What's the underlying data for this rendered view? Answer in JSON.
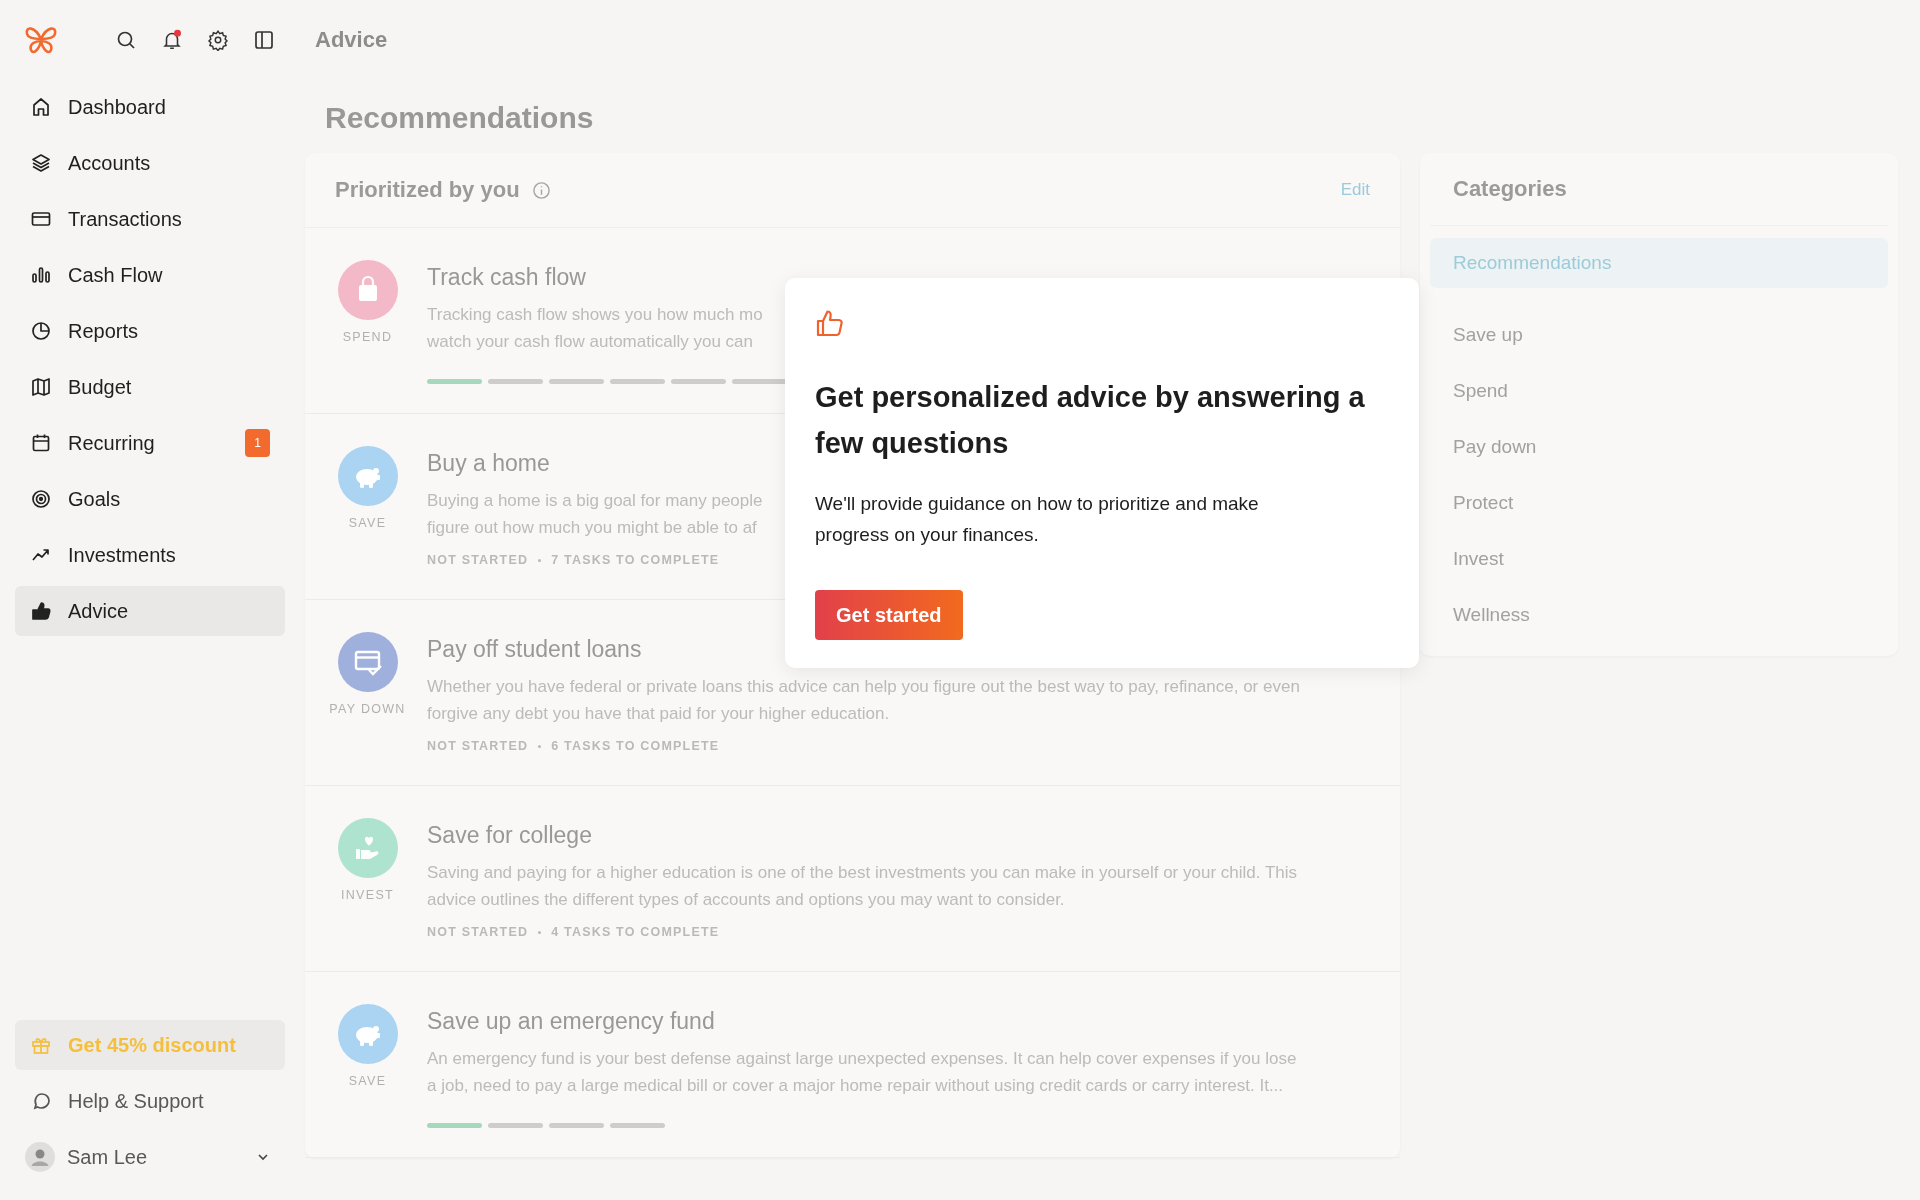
{
  "topbar": {
    "title": "Advice",
    "notification_dot": true
  },
  "sidebar": {
    "items": [
      {
        "label": "Dashboard",
        "kind": "home",
        "selected": false
      },
      {
        "label": "Accounts",
        "kind": "layers",
        "selected": false
      },
      {
        "label": "Transactions",
        "kind": "card",
        "selected": false
      },
      {
        "label": "Cash Flow",
        "kind": "bars",
        "selected": false
      },
      {
        "label": "Reports",
        "kind": "pie",
        "selected": false
      },
      {
        "label": "Budget",
        "kind": "map",
        "selected": false
      },
      {
        "label": "Recurring",
        "kind": "calendar",
        "selected": false,
        "badge": "1"
      },
      {
        "label": "Goals",
        "kind": "target",
        "selected": false
      },
      {
        "label": "Investments",
        "kind": "trend",
        "selected": false
      },
      {
        "label": "Advice",
        "kind": "thumb",
        "selected": true
      }
    ],
    "promo": "Get 45% discount",
    "help": "Help & Support",
    "user": "Sam Lee"
  },
  "page_title": "Recommendations",
  "priorities": {
    "title": "Prioritized by you",
    "edit": "Edit",
    "items": [
      {
        "title": "Track cash flow",
        "category": "SPEND",
        "kind": "bag",
        "color": "#f4b9c8",
        "description": [
          "Tracking cash flow shows you how much mo",
          "watch your cash flow automatically you can"
        ],
        "steps": [
          {
            "done": true
          },
          {
            "done": false
          },
          {
            "done": false
          },
          {
            "done": false
          },
          {
            "done": false
          },
          {
            "done": false
          }
        ]
      },
      {
        "title": "Buy a home",
        "category": "SAVE",
        "kind": "piggy",
        "color": "#aad4f1",
        "description": [
          "Buying a home is a big goal for many people",
          "figure out how much you might be able to af"
        ],
        "status": "NOT STARTED",
        "tasks": "7 TASKS TO COMPLETE"
      },
      {
        "title": "Pay off student loans",
        "category": "PAY DOWN",
        "kind": "bill",
        "color": "#a0b0dc",
        "description": [
          "Whether you have federal or private loans this advice can help you figure out the best way to pay, refinance, or even",
          "forgive any debt you have that paid for your higher education."
        ],
        "status": "NOT STARTED",
        "tasks": "6 TASKS TO COMPLETE"
      },
      {
        "title": "Save for college",
        "category": "INVEST",
        "kind": "hand",
        "color": "#ade3cf",
        "description": [
          "Saving and paying for a higher education is one of the best investments you can make in yourself or your child. This",
          "advice outlines the different types of accounts and options you may want to consider."
        ],
        "status": "NOT STARTED",
        "tasks": "4 TASKS TO COMPLETE"
      },
      {
        "title": "Save up an emergency fund",
        "category": "SAVE",
        "kind": "piggy",
        "color": "#aad4f1",
        "description": [
          "An emergency fund is your best defense against large unexpected expenses. It can help cover expenses if you lose",
          "a job, need to pay a large medical bill or cover a major home repair without using credit cards or carry interest. It..."
        ],
        "steps": [
          {
            "done": true
          },
          {
            "done": false
          },
          {
            "done": false
          },
          {
            "done": false
          }
        ]
      }
    ]
  },
  "categories": {
    "title": "Categories",
    "items": [
      {
        "label": "Recommendations",
        "selected": true
      },
      {
        "label": "Save up",
        "selected": false
      },
      {
        "label": "Spend",
        "selected": false
      },
      {
        "label": "Pay down",
        "selected": false
      },
      {
        "label": "Protect",
        "selected": false
      },
      {
        "label": "Invest",
        "selected": false
      },
      {
        "label": "Wellness",
        "selected": false
      }
    ]
  },
  "dialog": {
    "heading": "Get personalized advice by answering a few questions",
    "body": "We'll provide guidance on how to prioritize and make progress on your finances.",
    "button": "Get started"
  }
}
